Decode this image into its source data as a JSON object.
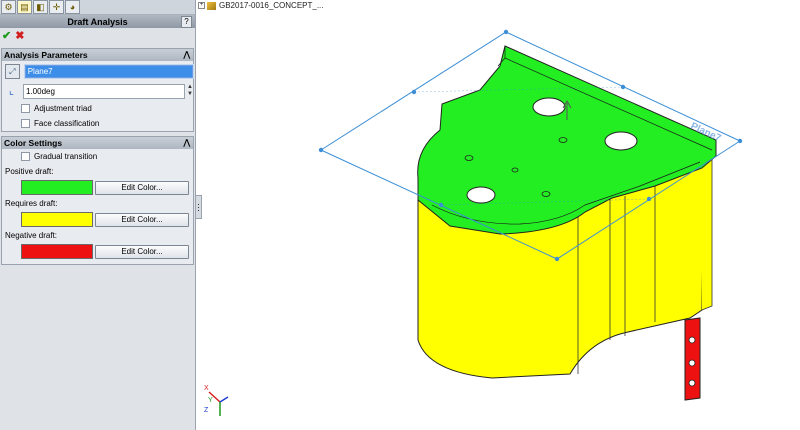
{
  "window": {
    "document_title": "GB2017-0016_CONCEPT_..."
  },
  "tabs": [
    {
      "icon": "feature-manager-icon"
    },
    {
      "icon": "property-manager-icon"
    },
    {
      "icon": "configuration-manager-icon"
    },
    {
      "icon": "dimxpert-manager-icon"
    },
    {
      "icon": "display-manager-icon"
    }
  ],
  "property_manager": {
    "title": "Draft Analysis",
    "help": "?",
    "ok_symbol": "✔",
    "cancel_symbol": "✖"
  },
  "analysis_parameters": {
    "header": "Analysis Parameters",
    "direction_value": "Plane7",
    "angle_value": "1.00deg",
    "adjustment_triad": "Adjustment triad",
    "face_classification": "Face classification"
  },
  "color_settings": {
    "header": "Color Settings",
    "gradual_transition": "Gradual transition",
    "positive_label": "Positive draft:",
    "positive_color": "#22ee22",
    "requires_label": "Requires draft:",
    "requires_color": "#ffff00",
    "negative_label": "Negative draft:",
    "negative_color": "#ee1111",
    "edit_color_label": "Edit Color..."
  },
  "model": {
    "plane_label": "Plane7",
    "positive_face_color": "#22ee22",
    "requires_face_color": "#ffff00",
    "negative_face_color": "#ee1111",
    "plane_color": "#3c8fd6"
  },
  "triad": {
    "x_label": "X",
    "y_label": "Y",
    "z_label": "Z"
  }
}
